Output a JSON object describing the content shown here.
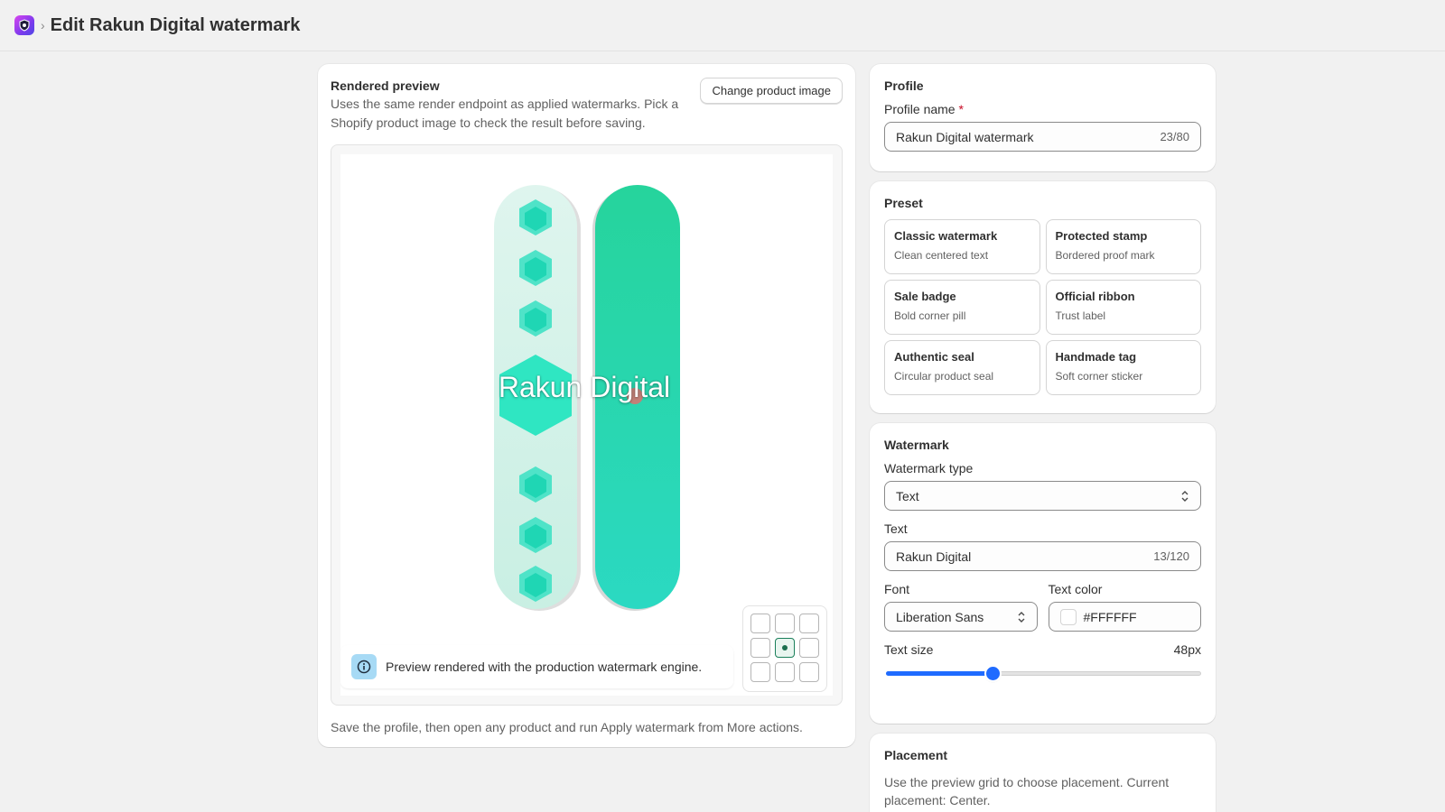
{
  "header": {
    "app_icon": "watermark-app-icon",
    "breadcrumb_separator": "›",
    "title": "Edit Rakun Digital watermark"
  },
  "preview": {
    "title": "Rendered preview",
    "description": "Uses the same render endpoint as applied watermarks. Pick a Shopify product image to check the result before saving.",
    "change_image_label": "Change product image",
    "watermark_text": "Rakun Digital",
    "info_text": "Preview rendered with the production watermark engine.",
    "footer": "Save the profile, then open any product and run Apply watermark from More actions.",
    "selected_cell": 4
  },
  "profile": {
    "title": "Profile",
    "name_label": "Profile name",
    "required_mark": "*",
    "name_value": "Rakun Digital watermark",
    "name_counter": "23/80"
  },
  "preset": {
    "title": "Preset",
    "items": [
      {
        "name": "Classic watermark",
        "desc": "Clean centered text"
      },
      {
        "name": "Protected stamp",
        "desc": "Bordered proof mark"
      },
      {
        "name": "Sale badge",
        "desc": "Bold corner pill"
      },
      {
        "name": "Official ribbon",
        "desc": "Trust label"
      },
      {
        "name": "Authentic seal",
        "desc": "Circular product seal"
      },
      {
        "name": "Handmade tag",
        "desc": "Soft corner sticker"
      }
    ]
  },
  "watermark": {
    "title": "Watermark",
    "type_label": "Watermark type",
    "type_value": "Text",
    "text_label": "Text",
    "text_value": "Rakun Digital",
    "text_counter": "13/120",
    "font_label": "Font",
    "font_value": "Liberation Sans",
    "color_label": "Text color",
    "color_value": "#FFFFFF",
    "size_label": "Text size",
    "size_value": "48px",
    "size_fraction": 0.34,
    "accent_color": "#1f6bff"
  },
  "placement": {
    "title": "Placement",
    "description": "Use the preview grid to choose placement. Current placement: Center."
  }
}
